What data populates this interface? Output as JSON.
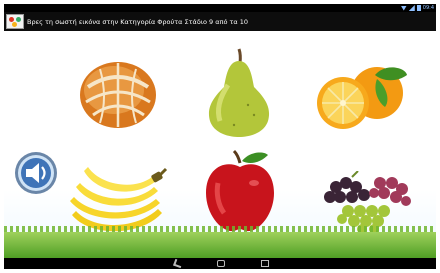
{
  "title": "Βρες τη σωστή εικόνα στην Κατηγορία Φρούτα Στάδιο 9 από τα 10",
  "status": {
    "time": "09:4"
  },
  "fruits": [
    {
      "icon": "mandarin-icon"
    },
    {
      "icon": "pear-icon"
    },
    {
      "icon": "orange-icon"
    },
    {
      "icon": "banana-icon"
    },
    {
      "icon": "apple-icon"
    },
    {
      "icon": "grapes-icon"
    }
  ],
  "colors": {
    "titlebar": "#0d0d0d",
    "grass": "#4f9f25",
    "statusAccent": "#8fc0ff"
  }
}
